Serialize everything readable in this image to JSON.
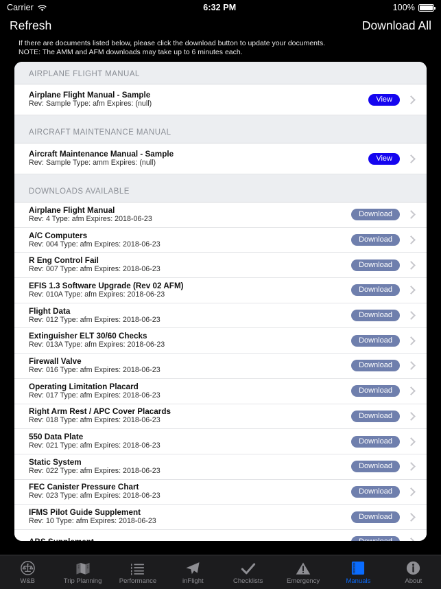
{
  "status_bar": {
    "carrier": "Carrier",
    "wifi_icon": "wifi-icon",
    "time": "6:32 PM",
    "battery_percent": "100%",
    "battery_icon": "battery-full-icon"
  },
  "nav_bar": {
    "refresh_label": "Refresh",
    "download_all_label": "Download All"
  },
  "instructions": {
    "line1": "If there are documents listed below, please click the download button to update your documents.",
    "line2": "NOTE: The AMM and AFM downloads may take up to 6 minutes each."
  },
  "colors": {
    "view_button": "#1505ef",
    "download_button": "#6f7fad",
    "active_tab": "#0a6cff",
    "section_header_bg": "#eceef1",
    "card_bg": "#ffffff",
    "page_bg": "#000000"
  },
  "sections": [
    {
      "header": "AIRPLANE FLIGHT MANUAL",
      "rows": [
        {
          "title": "Airplane Flight Manual - Sample",
          "meta": "Rev: Sample Type: afm  Expires: (null)",
          "action": "View",
          "action_type": "view"
        }
      ]
    },
    {
      "header": "AIRCRAFT MAINTENANCE MANUAL",
      "rows": [
        {
          "title": "Aircraft Maintenance Manual - Sample",
          "meta": "Rev: Sample Type: amm  Expires: (null)",
          "action": "View",
          "action_type": "view"
        }
      ]
    },
    {
      "header": "DOWNLOADS AVAILABLE",
      "rows": [
        {
          "title": "Airplane Flight Manual",
          "meta": "Rev: 4 Type: afm  Expires: 2018-06-23",
          "action": "Download",
          "action_type": "download"
        },
        {
          "title": "A/C Computers",
          "meta": "Rev: 004 Type: afm  Expires: 2018-06-23",
          "action": "Download",
          "action_type": "download"
        },
        {
          "title": "R Eng Control Fail",
          "meta": "Rev: 007 Type: afm  Expires: 2018-06-23",
          "action": "Download",
          "action_type": "download"
        },
        {
          "title": "EFIS 1.3 Software Upgrade (Rev 02 AFM)",
          "meta": "Rev: 010A Type: afm  Expires: 2018-06-23",
          "action": "Download",
          "action_type": "download"
        },
        {
          "title": "Flight Data",
          "meta": "Rev: 012 Type: afm  Expires: 2018-06-23",
          "action": "Download",
          "action_type": "download"
        },
        {
          "title": "Extinguisher ELT 30/60 Checks",
          "meta": "Rev: 013A Type: afm  Expires: 2018-06-23",
          "action": "Download",
          "action_type": "download"
        },
        {
          "title": "Firewall Valve",
          "meta": "Rev: 016 Type: afm  Expires: 2018-06-23",
          "action": "Download",
          "action_type": "download"
        },
        {
          "title": "Operating Limitation Placard",
          "meta": "Rev: 017 Type: afm  Expires: 2018-06-23",
          "action": "Download",
          "action_type": "download"
        },
        {
          "title": "Right Arm Rest / APC Cover Placards",
          "meta": "Rev: 018 Type: afm  Expires: 2018-06-23",
          "action": "Download",
          "action_type": "download"
        },
        {
          "title": "550 Data Plate",
          "meta": "Rev: 021 Type: afm  Expires: 2018-06-23",
          "action": "Download",
          "action_type": "download"
        },
        {
          "title": "Static System",
          "meta": "Rev: 022 Type: afm  Expires: 2018-06-23",
          "action": "Download",
          "action_type": "download"
        },
        {
          "title": "FEC Canister Pressure Chart",
          "meta": "Rev: 023 Type: afm  Expires: 2018-06-23",
          "action": "Download",
          "action_type": "download"
        },
        {
          "title": "IFMS Pilot Guide Supplement",
          "meta": "Rev: 10 Type: afm  Expires: 2018-06-23",
          "action": "Download",
          "action_type": "download"
        },
        {
          "title": "ABS Supplement",
          "meta": "",
          "action": "Download",
          "action_type": "download"
        }
      ]
    }
  ],
  "tab_bar": {
    "active_index": 6,
    "tabs": [
      {
        "label": "W&B",
        "icon": "scales-balance-icon"
      },
      {
        "label": "Trip Planning",
        "icon": "folded-map-icon"
      },
      {
        "label": "Performance",
        "icon": "list-lines-icon"
      },
      {
        "label": "inFlight",
        "icon": "paper-plane-icon"
      },
      {
        "label": "Checklists",
        "icon": "checkmark-icon"
      },
      {
        "label": "Emergency",
        "icon": "warning-triangle-icon"
      },
      {
        "label": "Manuals",
        "icon": "book-icon"
      },
      {
        "label": "About",
        "icon": "info-circle-icon"
      }
    ]
  }
}
